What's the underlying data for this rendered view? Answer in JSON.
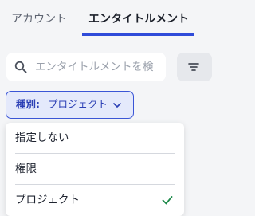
{
  "tabs": {
    "account_label": "アカウント",
    "entitlement_label": "エンタイトルメント"
  },
  "search": {
    "placeholder": "エンタイトルメントを検",
    "value": ""
  },
  "filter_button": {
    "icon": "filter-icon"
  },
  "type_filter": {
    "label": "種別:",
    "value": "プロジェクト",
    "icon": "chevron-down-icon"
  },
  "dropdown": {
    "options": [
      {
        "label": "指定しない",
        "selected": false
      },
      {
        "label": "権限",
        "selected": false
      },
      {
        "label": "プロジェクト",
        "selected": true
      }
    ]
  },
  "colors": {
    "accent": "#2f4bd9",
    "chip_bg": "#e4e9fb",
    "check": "#1e8a4a"
  }
}
